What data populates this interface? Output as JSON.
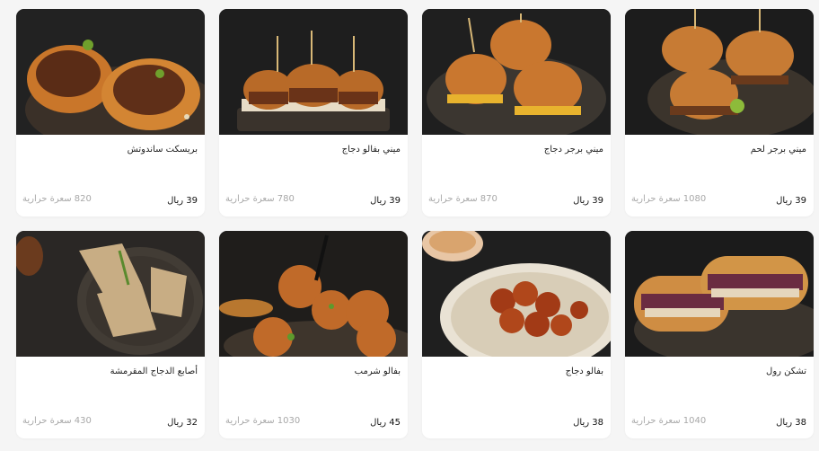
{
  "menu": {
    "items": [
      {
        "name": "بريسكت ساندوتش",
        "price": "39 ريال",
        "calories": "820 سعرة حرارية",
        "image": "brisket-sandwich"
      },
      {
        "name": "ميني بفالو دجاج",
        "price": "39 ريال",
        "calories": "780 سعرة حرارية",
        "image": "mini-buffalo-chicken"
      },
      {
        "name": "ميني برجر دجاج",
        "price": "39 ريال",
        "calories": "870 سعرة حرارية",
        "image": "mini-chicken-burger"
      },
      {
        "name": "ميني برجر لحم",
        "price": "39 ريال",
        "calories": "1080 سعرة حرارية",
        "image": "mini-beef-burger"
      },
      {
        "name": "أصابع الدجاج المقرمشة",
        "price": "32 ريال",
        "calories": "430 سعرة حرارية",
        "image": "crispy-chicken-fingers"
      },
      {
        "name": "بفالو شرمب",
        "price": "45 ريال",
        "calories": "1030 سعرة حرارية",
        "image": "buffalo-shrimp"
      },
      {
        "name": "بفالو دجاج",
        "price": "38 ريال",
        "calories": "",
        "image": "buffalo-chicken"
      },
      {
        "name": "تشكن رول",
        "price": "38 ريال",
        "calories": "1040 سعرة حرارية",
        "image": "chicken-roll"
      }
    ]
  }
}
